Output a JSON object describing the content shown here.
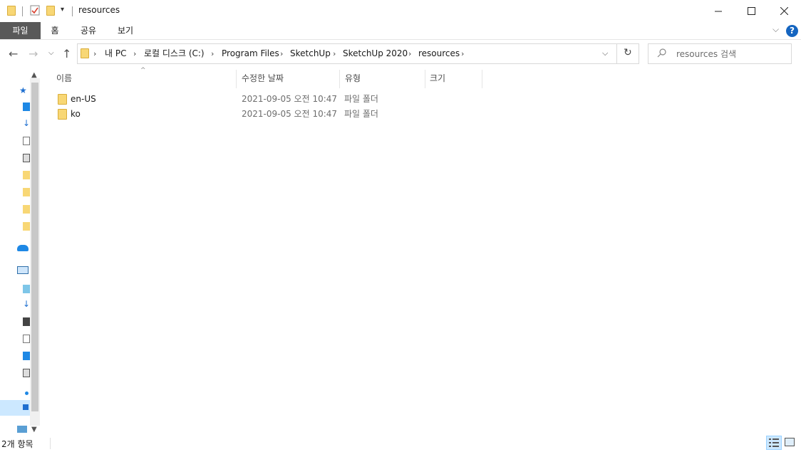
{
  "window": {
    "title": "resources"
  },
  "ribbon": {
    "tabs": [
      "파일",
      "홈",
      "공유",
      "보기"
    ]
  },
  "breadcrumb": [
    "내 PC",
    "로컬 디스크 (C:)",
    "Program Files",
    "SketchUp",
    "SketchUp 2020",
    "resources"
  ],
  "search": {
    "placeholder": "resources 검색"
  },
  "columns": {
    "name": "이름",
    "modified": "수정한 날짜",
    "type": "유형",
    "size": "크기"
  },
  "files": [
    {
      "name": "en-US",
      "modified": "2021-09-05 오전 10:47",
      "type": "파일 폴더",
      "size": ""
    },
    {
      "name": "ko",
      "modified": "2021-09-05 오전 10:47",
      "type": "파일 폴더",
      "size": ""
    }
  ],
  "status": {
    "item_count": "2개 항목"
  },
  "colors": {
    "folder": "#f8d775",
    "active_tab": "#595959",
    "help": "#1565c0",
    "selected_view": "#cce8ff"
  }
}
